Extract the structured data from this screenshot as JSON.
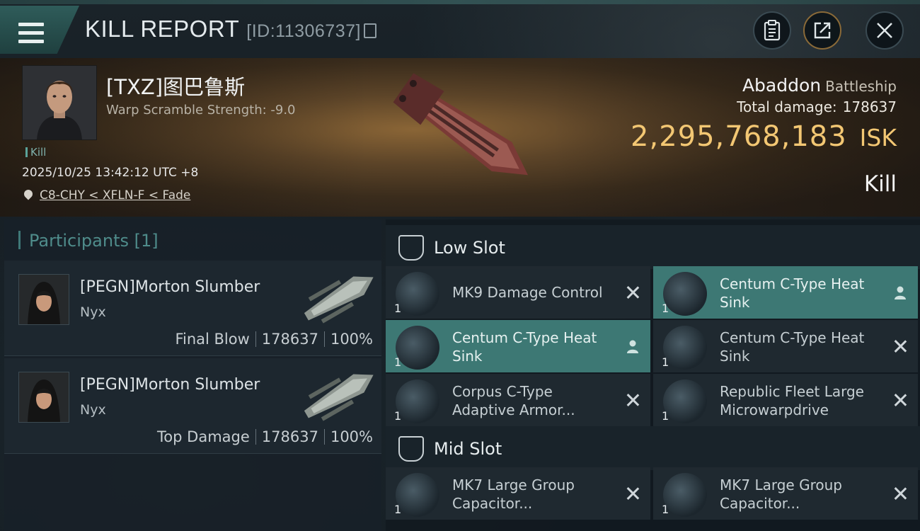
{
  "header": {
    "title": "KILL REPORT",
    "report_id": "[ID:11306737]"
  },
  "victim": {
    "name": "[TXZ]图巴鲁斯",
    "subtitle": "Warp Scramble Strength: -9.0",
    "tag": "Kill",
    "timestamp": "2025/10/25 13:42:12 UTC +8",
    "location": "C8-CHY < XFLN-F < Fade",
    "ship_name": "Abaddon",
    "ship_class": "Battleship",
    "total_damage_label": "Total damage:",
    "total_damage": "178637",
    "isk_value": "2,295,768,183",
    "isk_unit": "ISK",
    "outcome": "Kill"
  },
  "participants": {
    "header": "Participants [1]",
    "rows": [
      {
        "name": "[PEGN]Morton Slumber",
        "ship": "Nyx",
        "role": "Final Blow",
        "damage": "178637",
        "percent": "100%"
      },
      {
        "name": "[PEGN]Morton Slumber",
        "ship": "Nyx",
        "role": "Top Damage",
        "damage": "178637",
        "percent": "100%"
      }
    ]
  },
  "fitting": {
    "low_slot_label": "Low Slot",
    "mid_slot_label": "Mid Slot",
    "low_items": [
      {
        "name": "MK9 Damage Control",
        "qty": "1",
        "status": "destroyed",
        "icon": "damage-control-icon"
      },
      {
        "name": "Centum C-Type Heat Sink",
        "qty": "1",
        "status": "dropped",
        "icon": "heat-sink-icon"
      },
      {
        "name": "Centum C-Type Heat Sink",
        "qty": "1",
        "status": "dropped",
        "icon": "heat-sink-icon"
      },
      {
        "name": "Centum C-Type Heat Sink",
        "qty": "1",
        "status": "destroyed",
        "icon": "heat-sink-icon"
      },
      {
        "name": "Corpus C-Type Adaptive Armor...",
        "qty": "1",
        "status": "destroyed",
        "icon": "armor-hardener-icon"
      },
      {
        "name": "Republic Fleet Large Microwarpdrive",
        "qty": "1",
        "status": "destroyed",
        "icon": "microwarpdrive-icon"
      }
    ],
    "mid_items": [
      {
        "name": "MK7 Large Group Capacitor...",
        "qty": "1",
        "status": "destroyed",
        "icon": "capacitor-icon"
      },
      {
        "name": "MK7 Large Group Capacitor...",
        "qty": "1",
        "status": "destroyed",
        "icon": "capacitor-icon"
      }
    ]
  },
  "colors": {
    "accent_teal": "#3d7874",
    "isk_gold": "#f3c773"
  }
}
